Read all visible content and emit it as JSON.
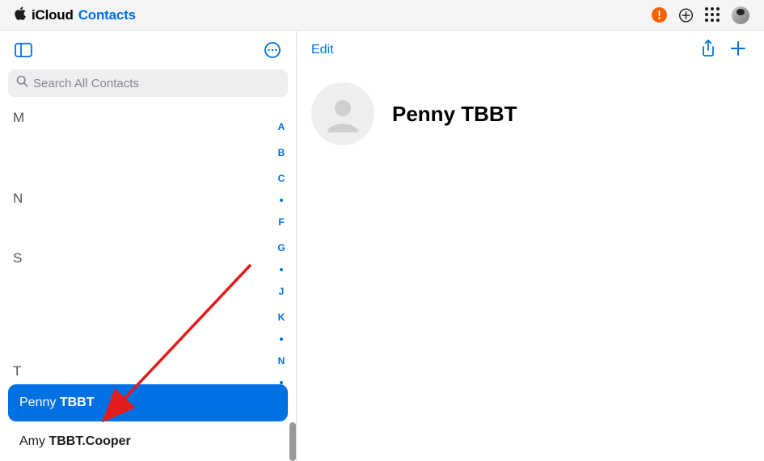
{
  "header": {
    "icloud_label": "iCloud",
    "app_label": "Contacts"
  },
  "sidebar": {
    "search_placeholder": "Search All Contacts",
    "sections": {
      "m": "M",
      "n": "N",
      "s": "S",
      "t": "T"
    },
    "contacts": {
      "penny": {
        "first": "Penny ",
        "last": "TBBT"
      },
      "amy": {
        "first": "Amy ",
        "last": "TBBT.Cooper"
      }
    },
    "index": [
      "A",
      "B",
      "C",
      "•",
      "F",
      "G",
      "•",
      "J",
      "K",
      "•",
      "N",
      "•"
    ]
  },
  "detail": {
    "edit_label": "Edit",
    "contact_name": "Penny TBBT"
  }
}
